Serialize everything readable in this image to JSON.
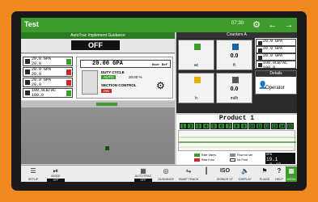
{
  "topbar": {
    "title": "Test",
    "clock": "07:30"
  },
  "autotrac": {
    "title": "AutoTrac Implement Guidance",
    "state": "OFF"
  },
  "left_rates": [
    {
      "rate": "20.0 GPA",
      "sub": "20.0"
    },
    {
      "rate": "20.0 GPA",
      "sub": "20.0"
    },
    {
      "rate": "20.0 GPA",
      "sub": "20.0"
    },
    {
      "rate": "100.0LB/AC",
      "sub": "100.0"
    }
  ],
  "center": {
    "rate": "20.00 GPA",
    "rate_tag": "User Def",
    "duty_cycle_label": "DUTY CYCLE",
    "auto_label": "AUTO",
    "duty_value": "20.00 %",
    "section_label": "SECTION CONTROL",
    "section_state": "ON"
  },
  "counters": {
    "title": "Counters A",
    "cells": [
      {
        "value": "",
        "unit": "ac"
      },
      {
        "value": "0.0",
        "unit": "ft"
      },
      {
        "value": "",
        "unit": "h"
      },
      {
        "value": "0.0",
        "unit": "mi/h"
      }
    ]
  },
  "right_rates": [
    "20.0 GPA",
    "20.0 GPA",
    "20.0 GPA",
    "100.0LB/AC",
    "100.0"
  ],
  "details": {
    "title": "Details",
    "operator": "Operator"
  },
  "product": {
    "title": "Product 1",
    "sections": [
      "1",
      "2",
      "3",
      "4",
      "5",
      "6",
      "7",
      "8",
      "9",
      "10",
      "11",
      "12",
      "13",
      "14",
      "15"
    ],
    "legend": [
      "Rate Varies",
      "Rate Error",
      "Flow not set",
      "No Prod"
    ],
    "summary_label": "GPA",
    "summary_values": [
      "19.1",
      "0.48"
    ]
  },
  "bottombar": {
    "setup": "SETUP",
    "mode": "MODE",
    "mode_state": "OFF",
    "autotrac": "AUTOTRAC",
    "autotrac_state": "OFF",
    "guidance": "GUIDANCE",
    "swap_track": "SWAP TRACK",
    "isobus": "ISOBUS VT",
    "display": "DISPLAY",
    "flags": "FLAGS",
    "help": "HELP",
    "menu": "MENU"
  },
  "colors": {
    "accent": "#3f9b2e",
    "bezel": "#f0891f",
    "danger": "#cc2a2a"
  }
}
